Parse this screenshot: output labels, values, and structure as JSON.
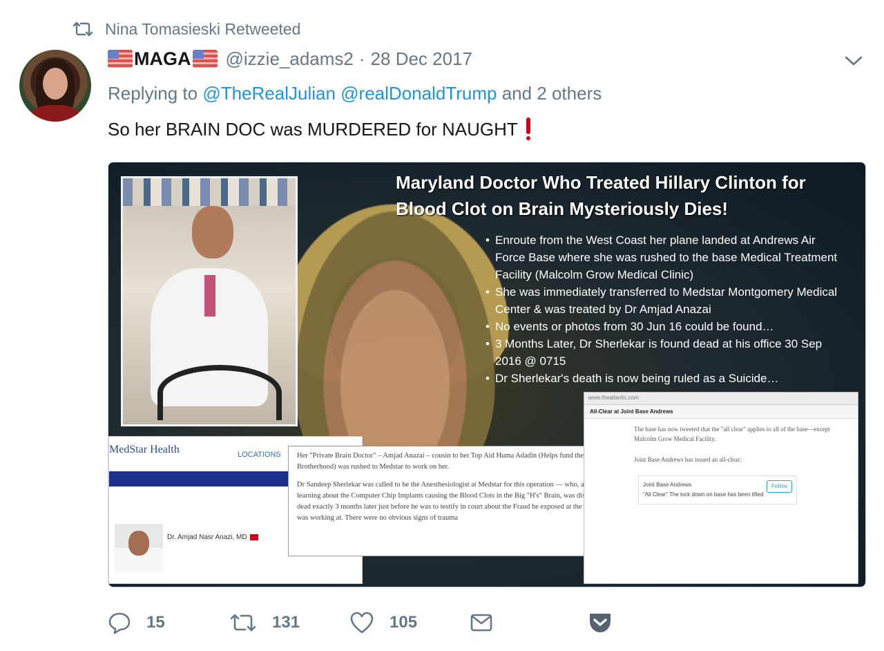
{
  "retweet_header": {
    "text": "Nina Tomasieski Retweeted",
    "icon": "retweet-icon"
  },
  "author": {
    "display_name": "MAGA",
    "flag_icon": "us-flag-emoji",
    "handle": "@izzie_adams2",
    "separator": "·",
    "date": "28 Dec 2017"
  },
  "reply_to": {
    "prefix": "Replying to",
    "user1": "@TheRealJulian",
    "user2": "@realDonaldTrump",
    "suffix": "and 2 others"
  },
  "tweet_text": "So her BRAIN DOC was MURDERED for NAUGHT",
  "media": {
    "headline": "Maryland Doctor Who Treated Hillary Clinton for Blood Clot on Brain Mysteriously Dies!",
    "bullets": [
      "Enroute from the West Coast her plane landed at Andrews Air Force Base where she was rushed to the base Medical Treatment Facility (Malcolm Grow Medical Clinic)",
      "She was immediately transferred to Medstar Montgomery Medical Center & was treated by Dr Amjad Anazai",
      "No events or photos from 30 Jun 16 could be found…",
      "3 Months Later, Dr Sherlekar is found dead at his office 30 Sep 2016 @ 0715",
      "Dr Sherlekar's death is now being ruled as a Suicide…"
    ],
    "medstar_logo": "MedStar Health",
    "medstar_locations": "LOCATIONS",
    "medstar_doctor": "Dr. Amjad Nasr Anazi, MD",
    "quote_p1": "Her \"Private Brain Doctor\" – Amjad Anazai – cousin to her Top Aid Huma Adadin (Helps fund the Muslim Brotherhood) was rushed to Medstar to work on her.",
    "quote_p2": "Dr Sandeep Sherlekar was called to be the Anesthesiologist at Medstar for this operation — who, after learning about the Computer Chip Implants causing the Blood Clots in the Big \"H's\" Brain, was discovered dead exactly 3 months later just before he was to testify in court about the Fraud he exposed at the clinic he was working at. There were no obvious signs of trauma",
    "browser_url": "www.theatlantic.com",
    "browser_nav": "All-Clear at Joint Base Andrews",
    "browser_p1": "The base has now tweeted that the \"all clear\" applies to all of the base—except Malcolm Grow Medical Facility.",
    "browser_p2": "Joint Base Andrews has issued an all-clear:",
    "browser_tweet_name": "Joint Base Andrews",
    "browser_tweet_follow": "Follow",
    "browser_tweet_text": "\"All Clear\" The lock down on base has been lifted"
  },
  "actions": {
    "reply": {
      "icon": "reply-icon",
      "count": "15"
    },
    "retweet": {
      "icon": "retweet-icon",
      "count": "131"
    },
    "like": {
      "icon": "heart-icon",
      "count": "105"
    },
    "dm": {
      "icon": "envelope-icon"
    },
    "pocket": {
      "icon": "pocket-icon"
    }
  },
  "colors": {
    "link": "#1b95e0",
    "muted": "#657786",
    "pocket": "#566270"
  }
}
